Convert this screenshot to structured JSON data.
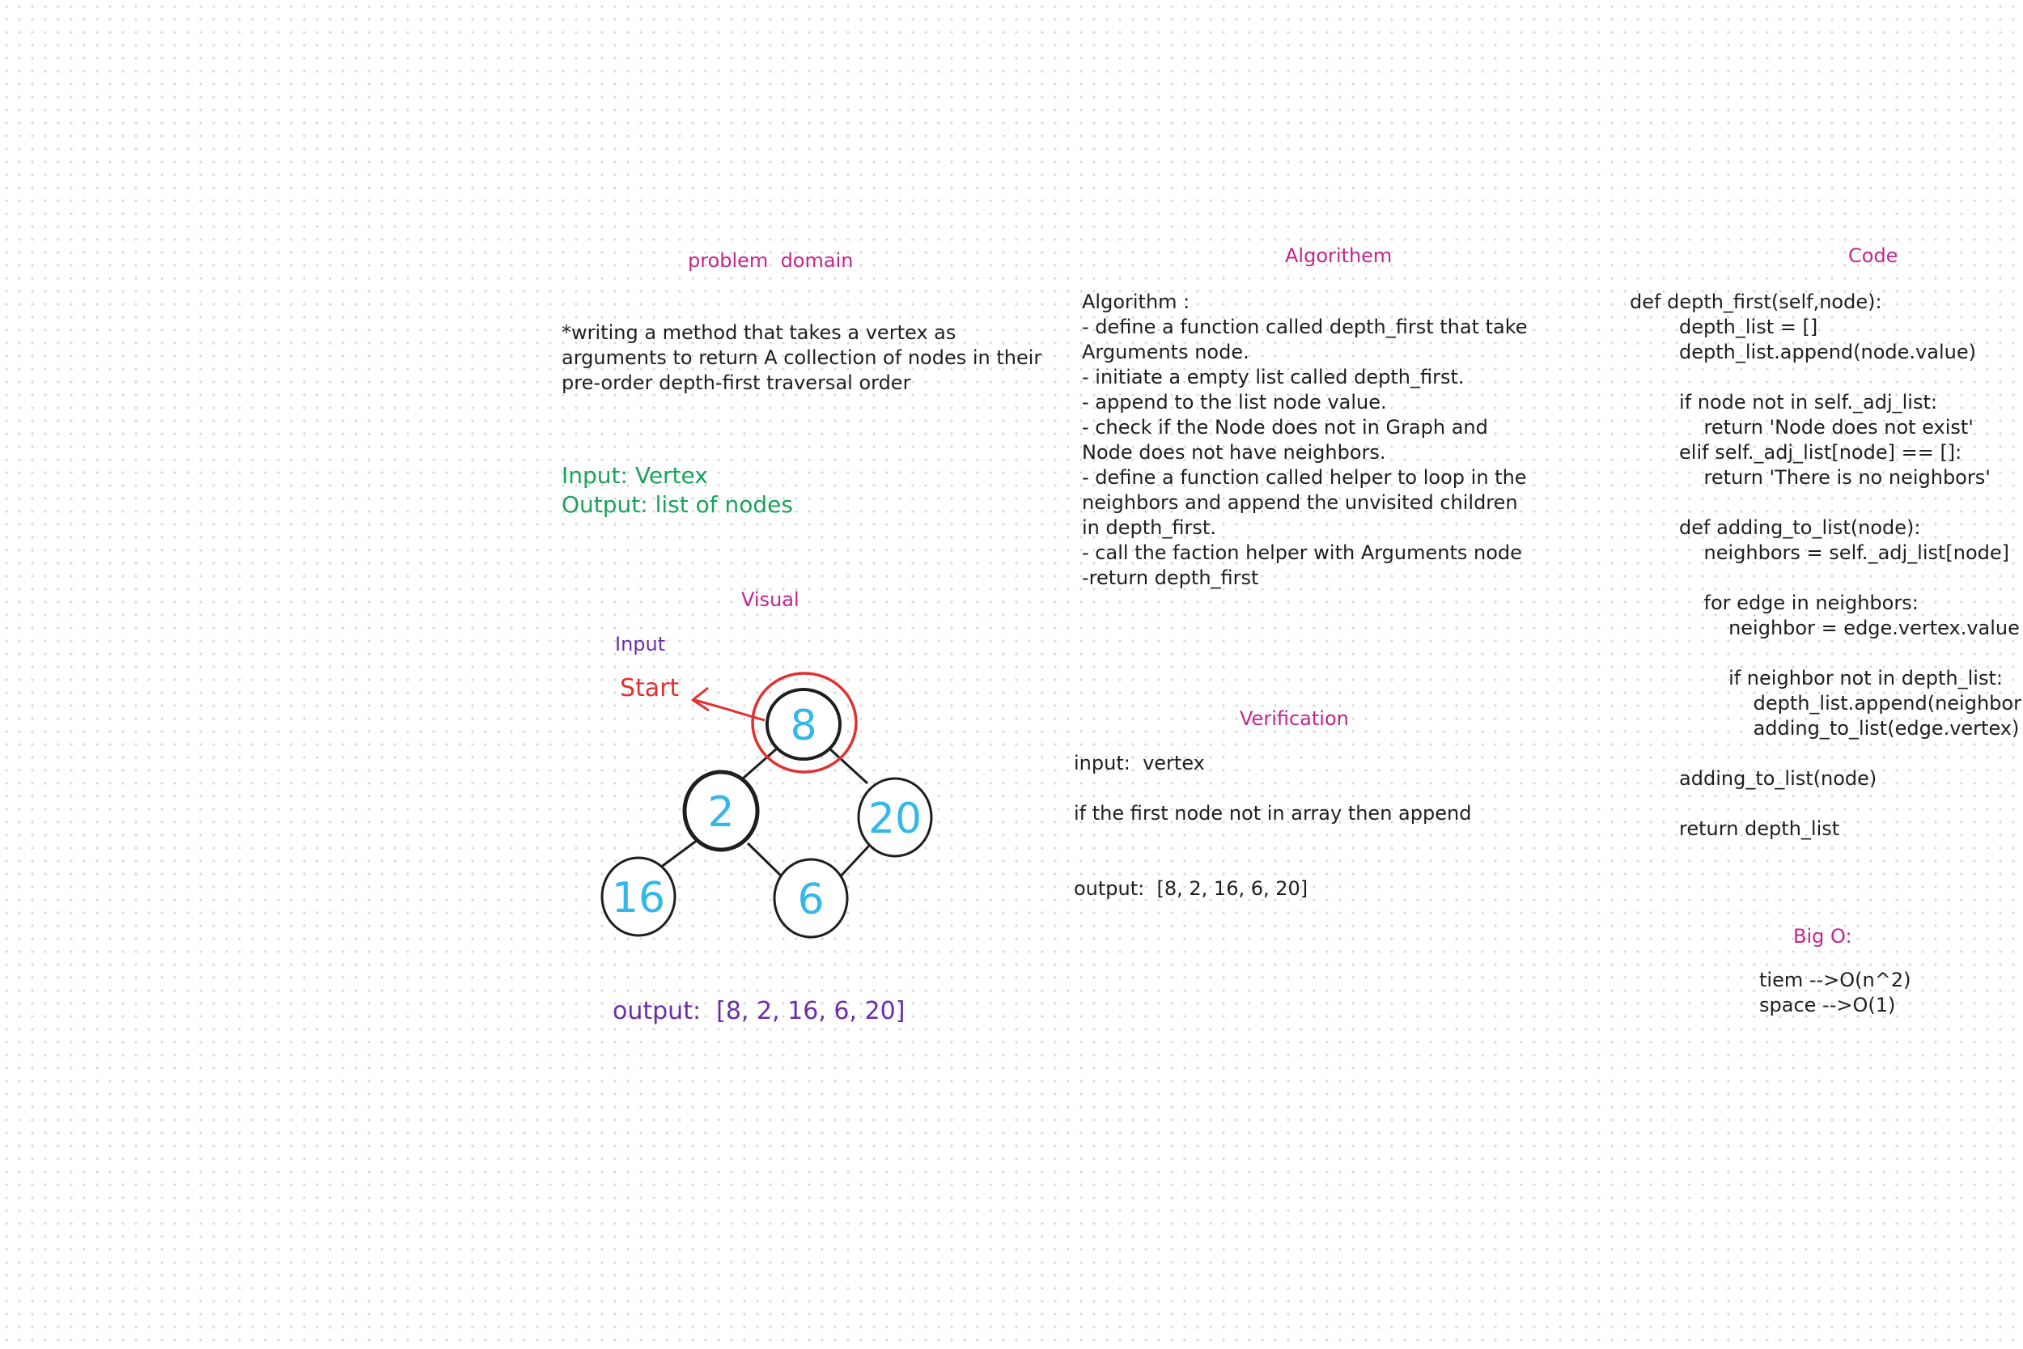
{
  "problem_domain": {
    "title": "problem  domain",
    "lines": [
      "*writing a method that takes a vertex as",
      "arguments to return A collection of nodes in their",
      "pre-order depth-first traversal order"
    ],
    "input": "Input: Vertex",
    "output": "Output: list of nodes"
  },
  "visual": {
    "title": "Visual",
    "input_label": "Input",
    "start_label": "Start",
    "nodes": {
      "n8": "8",
      "n2": "2",
      "n20": "20",
      "n16": "16",
      "n6": "6"
    },
    "output": "output:  [8, 2, 16, 6, 20]",
    "colors": {
      "node_text": "#33b8e8",
      "start": "#e03131",
      "label": "#6a2fa8"
    }
  },
  "algorithm": {
    "title": "Algorithem",
    "lines": [
      "Algorithm :",
      "- define a function called depth_first that take",
      "Arguments node.",
      "- initiate a empty list called depth_first.",
      "- append to the list node value.",
      "- check if the Node does not in Graph and",
      "Node does not have neighbors.",
      "- define a function called helper to loop in the",
      "neighbors and append the unvisited children",
      "in depth_first.",
      "- call the faction helper with Arguments node",
      "-return depth_first"
    ]
  },
  "verification": {
    "title": "Verification",
    "input": "input:  vertex",
    "condition": "if the first node not in array then append",
    "output": "output:  [8, 2, 16, 6, 20]"
  },
  "code": {
    "title": "Code",
    "lines": [
      "def depth_first(self,node):",
      "        depth_list = []",
      "        depth_list.append(node.value)",
      "",
      "        if node not in self._adj_list:",
      "            return 'Node does not exist'",
      "        elif self._adj_list[node] == []:",
      "            return 'There is no neighbors'",
      "",
      "        def adding_to_list(node):",
      "            neighbors = self._adj_list[node]",
      "",
      "            for edge in neighbors:",
      "                neighbor = edge.vertex.value",
      "",
      "                if neighbor not in depth_list:",
      "                    depth_list.append(neighbor)",
      "                    adding_to_list(edge.vertex)",
      "",
      "        adding_to_list(node)",
      "",
      "        return depth_list"
    ]
  },
  "big_o": {
    "title": "Big O:",
    "time": "tiem -->O(n^2)",
    "space": "space -->O(1)"
  }
}
